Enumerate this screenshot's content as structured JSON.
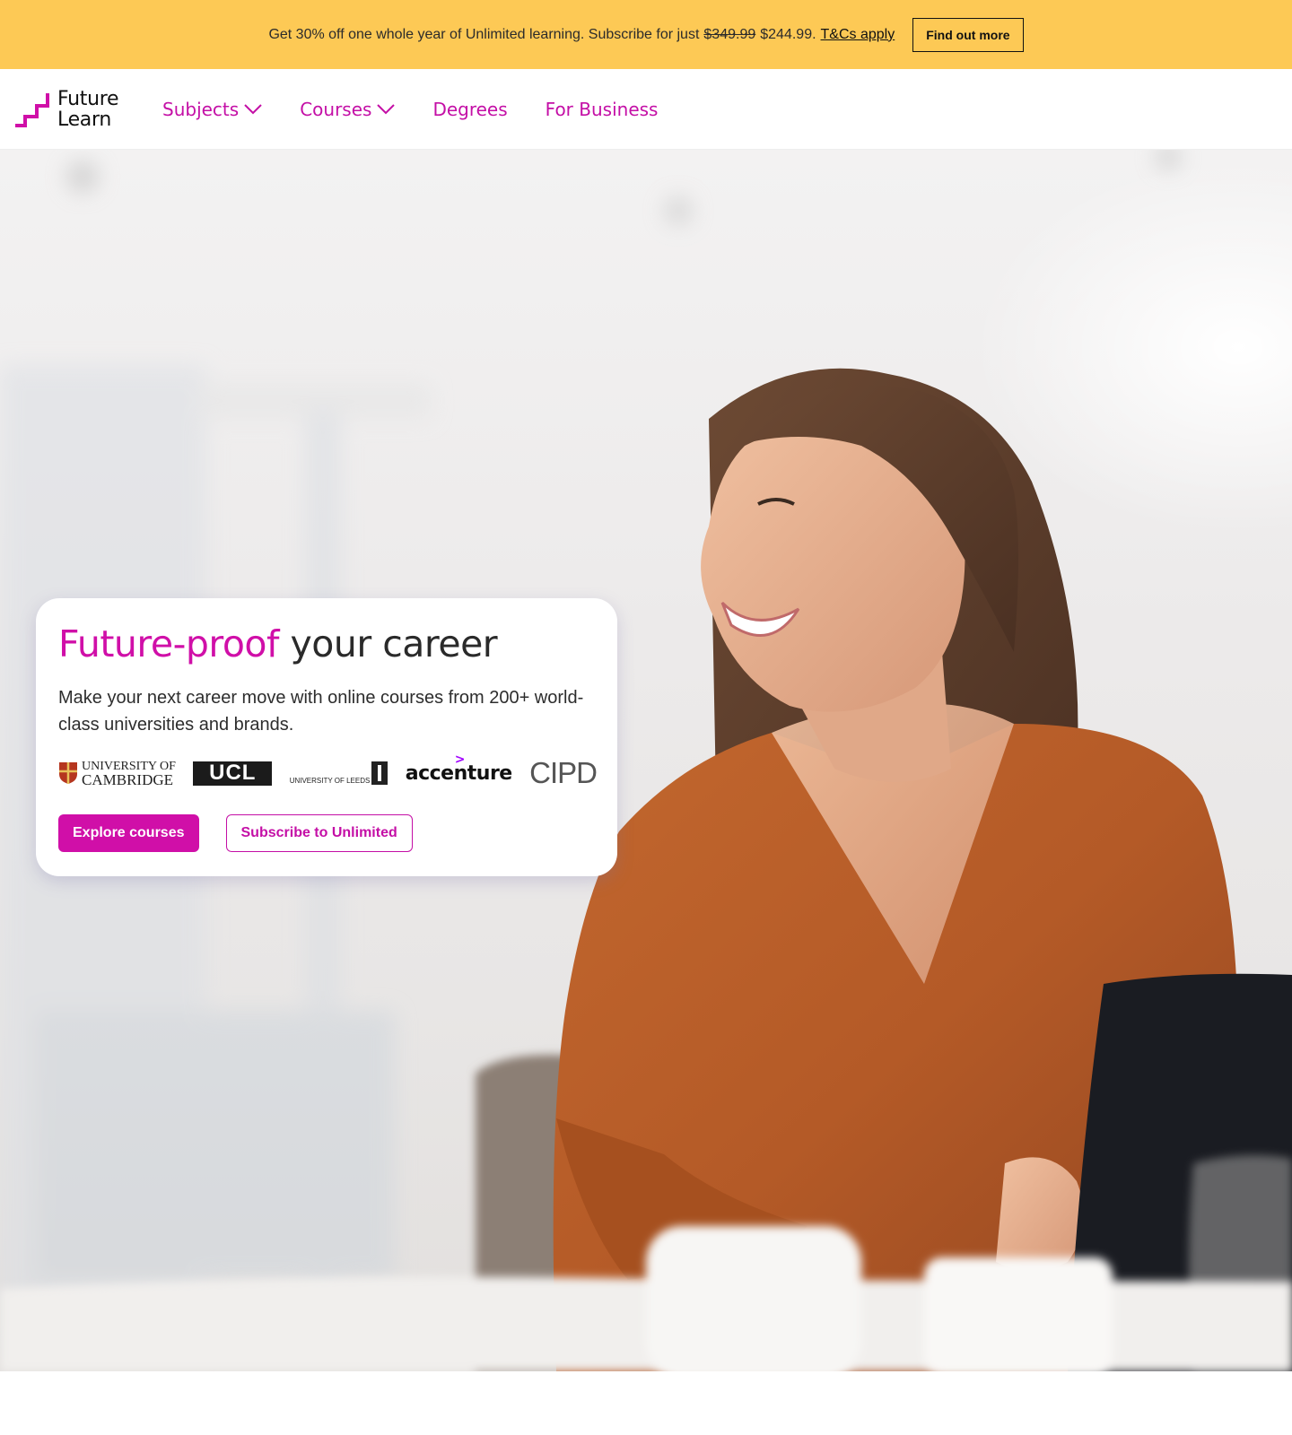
{
  "promo": {
    "text_before": "Get 30% off one whole year of Unlimited learning. Subscribe for just",
    "old_price": "$349.99",
    "new_price": "$244.99.",
    "terms_link": "T&Cs apply",
    "cta_label": "Find out more"
  },
  "logo": {
    "line1": "Future",
    "line2": "Learn"
  },
  "nav": {
    "subjects": "Subjects",
    "courses": "Courses",
    "degrees": "Degrees",
    "business": "For Business"
  },
  "hero": {
    "title_accent": "Future-proof",
    "title_rest": "your career",
    "description": "Make your next career move with online courses from 200+ world-class universities and brands.",
    "partners": {
      "cambridge_line1": "UNIVERSITY OF",
      "cambridge_line2": "CAMBRIDGE",
      "ucl": "UCL",
      "leeds": "UNIVERSITY OF LEEDS",
      "accenture": "accenture",
      "accenture_mark": ">",
      "cipd": "CIPD"
    },
    "primary_button": "Explore courses",
    "secondary_button": "Subscribe to Unlimited"
  },
  "colors": {
    "brand": "#d00fa8",
    "banner": "#fdc955"
  }
}
